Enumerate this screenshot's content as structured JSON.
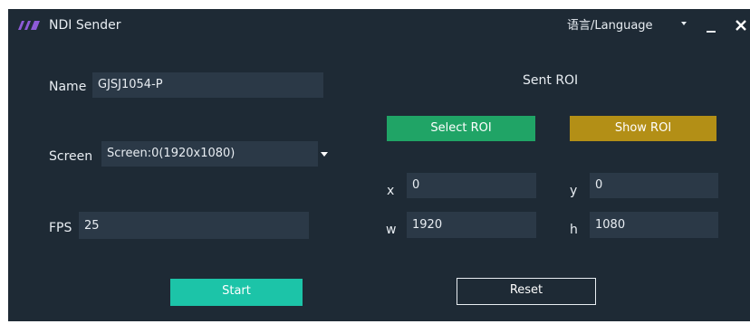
{
  "window": {
    "title": "NDI Sender",
    "language_label": "语言/Language"
  },
  "form": {
    "name_label": "Name",
    "name_value": "GJSJ1054-P",
    "screen_label": "Screen",
    "screen_value": "Screen:0(1920x1080)",
    "fps_label": "FPS",
    "fps_value": "25"
  },
  "roi": {
    "title": "Sent ROI",
    "select_label": "Select ROI",
    "show_label": "Show ROI",
    "x_label": "x",
    "x_value": "0",
    "y_label": "y",
    "y_value": "0",
    "w_label": "w",
    "w_value": "1920",
    "h_label": "h",
    "h_value": "1080"
  },
  "actions": {
    "start_label": "Start",
    "reset_label": "Reset"
  },
  "colors": {
    "background": "#1e2a35",
    "field": "#2b3947",
    "select_roi": "#20a466",
    "show_roi": "#b38f16",
    "start": "#1cc4a8",
    "logo": "#8e5bd8"
  }
}
